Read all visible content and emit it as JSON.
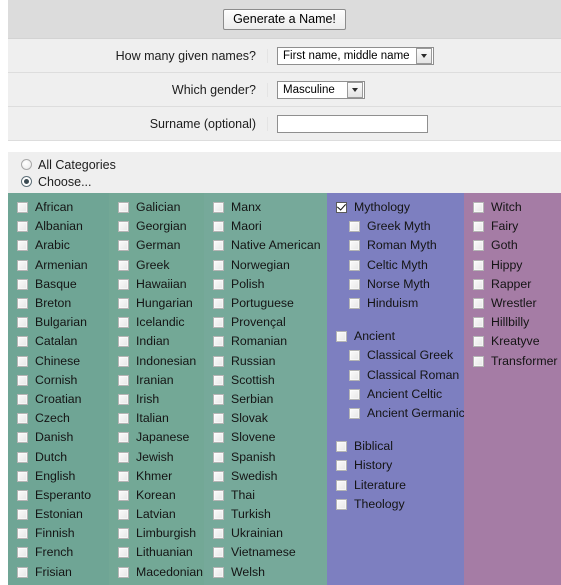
{
  "form": {
    "generate_button": "Generate a Name!",
    "fields": [
      {
        "label": "How many given names?",
        "type": "select",
        "value": "First name, middle name"
      },
      {
        "label": "Which gender?",
        "type": "select",
        "value": "Masculine"
      },
      {
        "label": "Surname (optional)",
        "type": "text",
        "value": "",
        "placeholder": ""
      }
    ]
  },
  "scope": {
    "all_categories": "All Categories",
    "choose": "Choose...",
    "selected": "choose"
  },
  "columns": [
    {
      "id": "col-1",
      "color": "#6fa595",
      "items": [
        {
          "label": "African",
          "checked": false
        },
        {
          "label": "Albanian",
          "checked": false
        },
        {
          "label": "Arabic",
          "checked": false
        },
        {
          "label": "Armenian",
          "checked": false
        },
        {
          "label": "Basque",
          "checked": false
        },
        {
          "label": "Breton",
          "checked": false
        },
        {
          "label": "Bulgarian",
          "checked": false
        },
        {
          "label": "Catalan",
          "checked": false
        },
        {
          "label": "Chinese",
          "checked": false
        },
        {
          "label": "Cornish",
          "checked": false
        },
        {
          "label": "Croatian",
          "checked": false
        },
        {
          "label": "Czech",
          "checked": false
        },
        {
          "label": "Danish",
          "checked": false
        },
        {
          "label": "Dutch",
          "checked": false
        },
        {
          "label": "English",
          "checked": false
        },
        {
          "label": "Esperanto",
          "checked": false
        },
        {
          "label": "Estonian",
          "checked": false
        },
        {
          "label": "Finnish",
          "checked": false
        },
        {
          "label": "French",
          "checked": false
        },
        {
          "label": "Frisian",
          "checked": false
        }
      ]
    },
    {
      "id": "col-2",
      "color": "#73a896",
      "items": [
        {
          "label": "Galician",
          "checked": false
        },
        {
          "label": "Georgian",
          "checked": false
        },
        {
          "label": "German",
          "checked": false
        },
        {
          "label": "Greek",
          "checked": false
        },
        {
          "label": "Hawaiian",
          "checked": false
        },
        {
          "label": "Hungarian",
          "checked": false
        },
        {
          "label": "Icelandic",
          "checked": false
        },
        {
          "label": "Indian",
          "checked": false
        },
        {
          "label": "Indonesian",
          "checked": false
        },
        {
          "label": "Iranian",
          "checked": false
        },
        {
          "label": "Irish",
          "checked": false
        },
        {
          "label": "Italian",
          "checked": false
        },
        {
          "label": "Japanese",
          "checked": false
        },
        {
          "label": "Jewish",
          "checked": false
        },
        {
          "label": "Khmer",
          "checked": false
        },
        {
          "label": "Korean",
          "checked": false
        },
        {
          "label": "Latvian",
          "checked": false
        },
        {
          "label": "Limburgish",
          "checked": false
        },
        {
          "label": "Lithuanian",
          "checked": false
        },
        {
          "label": "Macedonian",
          "checked": false
        }
      ]
    },
    {
      "id": "col-3",
      "color": "#76a99a",
      "items": [
        {
          "label": "Manx",
          "checked": false
        },
        {
          "label": "Maori",
          "checked": false
        },
        {
          "label": "Native American",
          "checked": false
        },
        {
          "label": "Norwegian",
          "checked": false
        },
        {
          "label": "Polish",
          "checked": false
        },
        {
          "label": "Portuguese",
          "checked": false
        },
        {
          "label": "Provençal",
          "checked": false
        },
        {
          "label": "Romanian",
          "checked": false
        },
        {
          "label": "Russian",
          "checked": false
        },
        {
          "label": "Scottish",
          "checked": false
        },
        {
          "label": "Serbian",
          "checked": false
        },
        {
          "label": "Slovak",
          "checked": false
        },
        {
          "label": "Slovene",
          "checked": false
        },
        {
          "label": "Spanish",
          "checked": false
        },
        {
          "label": "Swedish",
          "checked": false
        },
        {
          "label": "Thai",
          "checked": false
        },
        {
          "label": "Turkish",
          "checked": false
        },
        {
          "label": "Ukrainian",
          "checked": false
        },
        {
          "label": "Vietnamese",
          "checked": false
        },
        {
          "label": "Welsh",
          "checked": false
        }
      ]
    },
    {
      "id": "col-4",
      "color": "#7d7fc0",
      "items": [
        {
          "label": "Mythology",
          "checked": true,
          "indent": false
        },
        {
          "label": "Greek Myth",
          "checked": false,
          "indent": true
        },
        {
          "label": "Roman Myth",
          "checked": false,
          "indent": true
        },
        {
          "label": "Celtic Myth",
          "checked": false,
          "indent": true
        },
        {
          "label": "Norse Myth",
          "checked": false,
          "indent": true
        },
        {
          "label": "Hinduism",
          "checked": false,
          "indent": true
        },
        {
          "label": "Ancient",
          "checked": false,
          "indent": false,
          "gap": true
        },
        {
          "label": "Classical Greek",
          "checked": false,
          "indent": true
        },
        {
          "label": "Classical Roman",
          "checked": false,
          "indent": true
        },
        {
          "label": "Ancient Celtic",
          "checked": false,
          "indent": true
        },
        {
          "label": "Ancient Germanic",
          "checked": false,
          "indent": true
        },
        {
          "label": "Biblical",
          "checked": false,
          "indent": false,
          "gap": true
        },
        {
          "label": "History",
          "checked": false,
          "indent": false
        },
        {
          "label": "Literature",
          "checked": false,
          "indent": false
        },
        {
          "label": "Theology",
          "checked": false,
          "indent": false
        }
      ]
    },
    {
      "id": "col-5",
      "color": "#a57ca5",
      "items": [
        {
          "label": "Witch",
          "checked": false
        },
        {
          "label": "Fairy",
          "checked": false
        },
        {
          "label": "Goth",
          "checked": false
        },
        {
          "label": "Hippy",
          "checked": false
        },
        {
          "label": "Rapper",
          "checked": false
        },
        {
          "label": "Wrestler",
          "checked": false
        },
        {
          "label": "Hillbilly",
          "checked": false
        },
        {
          "label": "Kreatyve",
          "checked": false
        },
        {
          "label": "Transformer",
          "checked": false
        }
      ]
    }
  ]
}
